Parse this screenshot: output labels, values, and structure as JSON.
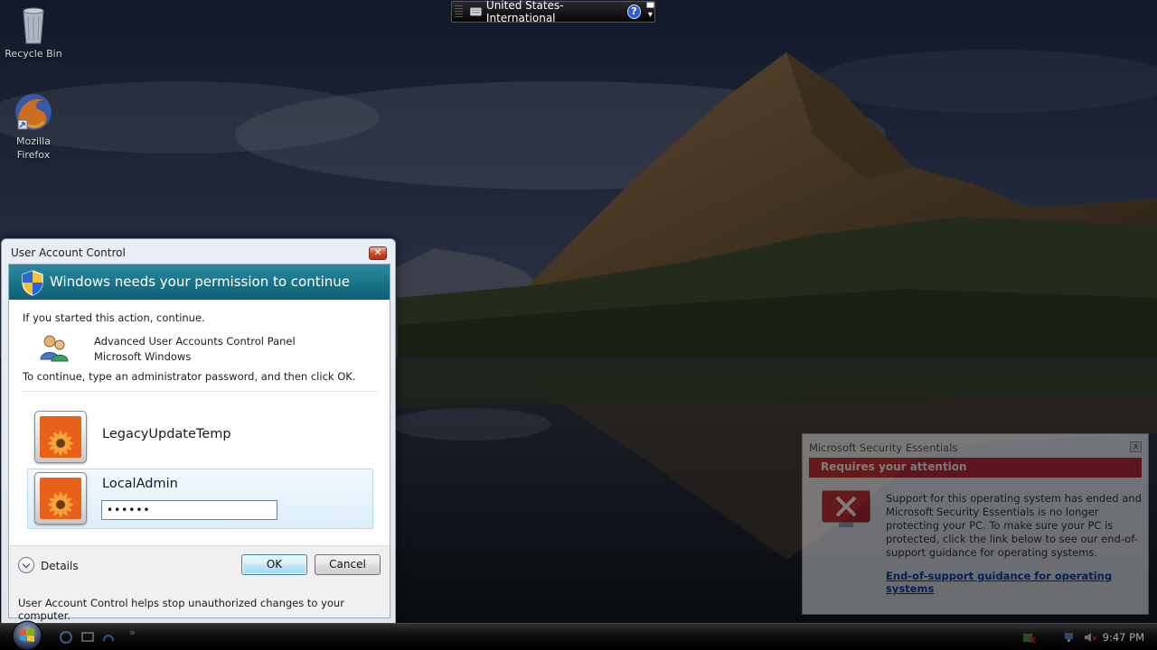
{
  "desktop": {
    "icons": [
      {
        "label": "Recycle Bin",
        "icon": "recycle-bin-icon"
      },
      {
        "label": "Mozilla\nFirefox",
        "icon": "firefox-icon"
      }
    ]
  },
  "language_bar": {
    "language": "United States-International",
    "help_symbol": "?",
    "options_symbol": "▾"
  },
  "uac_dialog": {
    "window_title": "User Account Control",
    "close_symbol": "✕",
    "heading": "Windows needs your permission to continue",
    "intro": "If you started this action, continue.",
    "program_name": "Advanced User Accounts Control Panel",
    "publisher": "Microsoft Windows",
    "instruction": "To continue, type an administrator password, and then click OK.",
    "users": [
      {
        "name": "LegacyUpdateTemp",
        "selected": false
      },
      {
        "name": "LocalAdmin",
        "selected": true
      }
    ],
    "password_value": "••••••",
    "details_label": "Details",
    "ok_label": "OK",
    "cancel_label": "Cancel",
    "footer_note": "User Account Control helps stop unauthorized changes to your computer."
  },
  "mse_notification": {
    "title": "Microsoft Security Essentials",
    "close_symbol": "x",
    "banner": "Requires your attention",
    "message": "Support for this operating system has ended and Microsoft Security Essentials is no longer protecting your PC. To make sure your PC is protected, click the link below to see our end-of-support guidance for operating systems.",
    "link": "End-of-support guidance for operating systems",
    "colors": {
      "banner": "#c0111a",
      "error_icon": "#c0111a"
    }
  },
  "taskbar": {
    "clock": "9:47 PM",
    "quick_launch_more": "»"
  },
  "colors": {
    "uac_header": "#167086",
    "ok_button_border": "#3c7fb1",
    "selected_user_bg": "#dbeef9"
  }
}
